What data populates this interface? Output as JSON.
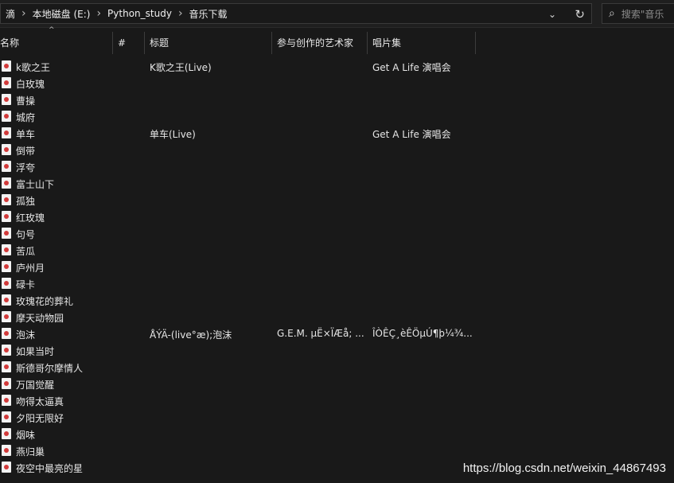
{
  "address_bar": {
    "crumbs": [
      "滴",
      "本地磁盘 (E:)",
      "Python_study",
      "音乐下载"
    ],
    "separator": "›",
    "dropdown_icon": "⌄",
    "refresh_icon": "↻"
  },
  "search": {
    "placeholder": "搜索\"音乐",
    "icon": "⌕"
  },
  "columns": {
    "name": "名称",
    "number": "#",
    "title": "标题",
    "artists": "参与创作的艺术家",
    "album": "唱片集"
  },
  "sort_indicator": "^",
  "rows": [
    {
      "name": "k歌之王",
      "title": "K歌之王(Live)",
      "artist": "",
      "album": "Get A Life 演唱会"
    },
    {
      "name": "白玫瑰",
      "title": "",
      "artist": "",
      "album": ""
    },
    {
      "name": "曹操",
      "title": "",
      "artist": "",
      "album": ""
    },
    {
      "name": "城府",
      "title": "",
      "artist": "",
      "album": ""
    },
    {
      "name": "单车",
      "title": "单车(Live)",
      "artist": "",
      "album": "Get A Life 演唱会"
    },
    {
      "name": "倒带",
      "title": "",
      "artist": "",
      "album": ""
    },
    {
      "name": "浮夸",
      "title": "",
      "artist": "",
      "album": ""
    },
    {
      "name": "富士山下",
      "title": "",
      "artist": "",
      "album": ""
    },
    {
      "name": "孤独",
      "title": "",
      "artist": "",
      "album": ""
    },
    {
      "name": "红玫瑰",
      "title": "",
      "artist": "",
      "album": ""
    },
    {
      "name": "句号",
      "title": "",
      "artist": "",
      "album": ""
    },
    {
      "name": "苦瓜",
      "title": "",
      "artist": "",
      "album": ""
    },
    {
      "name": "庐州月",
      "title": "",
      "artist": "",
      "album": ""
    },
    {
      "name": "碌卡",
      "title": "",
      "artist": "",
      "album": ""
    },
    {
      "name": "玫瑰花的葬礼",
      "title": "",
      "artist": "",
      "album": ""
    },
    {
      "name": "摩天动物园",
      "title": "",
      "artist": "",
      "album": ""
    },
    {
      "name": "泡沫",
      "title": "ÅÝÄ-(live°æ);泡沫",
      "artist": "G.E.M. µË×ÏÆå; ...",
      "album": "ÎÒÊÇ¸èÊÖµÚ¶þ¼¾..."
    },
    {
      "name": "如果当时",
      "title": "",
      "artist": "",
      "album": ""
    },
    {
      "name": "斯德哥尔摩情人",
      "title": "",
      "artist": "",
      "album": ""
    },
    {
      "name": "万国觉醒",
      "title": "",
      "artist": "",
      "album": ""
    },
    {
      "name": "吻得太逼真",
      "title": "",
      "artist": "",
      "album": ""
    },
    {
      "name": "夕阳无限好",
      "title": "",
      "artist": "",
      "album": ""
    },
    {
      "name": "烟味",
      "title": "",
      "artist": "",
      "album": ""
    },
    {
      "name": "燕归巢",
      "title": "",
      "artist": "",
      "album": ""
    },
    {
      "name": "夜空中最亮的星",
      "title": "",
      "artist": "",
      "album": ""
    }
  ],
  "watermark": "https://blog.csdn.net/weixin_44867493"
}
